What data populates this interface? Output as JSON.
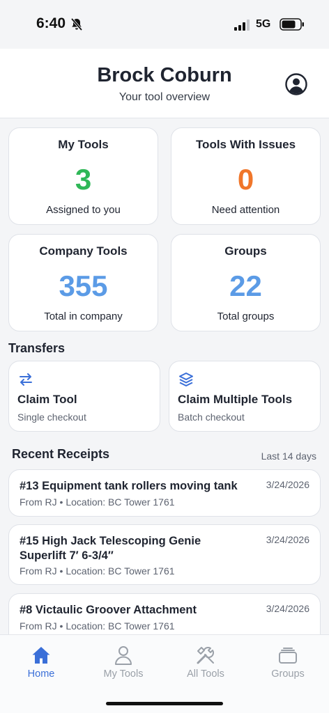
{
  "status_bar": {
    "time": "6:40",
    "network": "5G"
  },
  "header": {
    "title": "Brock Coburn",
    "subtitle": "Your tool overview"
  },
  "stats": [
    {
      "title": "My Tools",
      "value": "3",
      "caption": "Assigned to you",
      "color": "#2fb757"
    },
    {
      "title": "Tools With Issues",
      "value": "0",
      "caption": "Need attention",
      "color": "#f0762a"
    },
    {
      "title": "Company Tools",
      "value": "355",
      "caption": "Total in company",
      "color": "#5b9be6"
    },
    {
      "title": "Groups",
      "value": "22",
      "caption": "Total groups",
      "color": "#5b9be6"
    }
  ],
  "transfers": {
    "heading": "Transfers",
    "items": [
      {
        "title": "Claim Tool",
        "subtitle": "Single checkout",
        "icon": "swap-arrows-icon"
      },
      {
        "title": "Claim Multiple Tools",
        "subtitle": "Batch checkout",
        "icon": "layers-icon"
      }
    ]
  },
  "receipts": {
    "heading": "Recent Receipts",
    "range": "Last 14 days",
    "items": [
      {
        "title": "#13 Equipment tank rollers moving tank",
        "date": "3/24/2026",
        "meta": "From RJ • Location: BC Tower 1761"
      },
      {
        "title": "#15 High Jack Telescoping Genie Superlift 7′ 6-3/4″",
        "date": "3/24/2026",
        "meta": "From RJ • Location: BC Tower 1761"
      },
      {
        "title": "#8 Victaulic Groover Attachment",
        "date": "3/24/2026",
        "meta": "From RJ • Location: BC Tower 1761"
      }
    ]
  },
  "tabs": [
    {
      "label": "Home",
      "icon": "home-icon",
      "active": true
    },
    {
      "label": "My Tools",
      "icon": "person-icon",
      "active": false
    },
    {
      "label": "All Tools",
      "icon": "tools-icon",
      "active": false
    },
    {
      "label": "Groups",
      "icon": "folder-stack-icon",
      "active": false
    }
  ],
  "colors": {
    "accent": "#3a6fd8",
    "green": "#2fb757",
    "orange": "#f0762a",
    "blue": "#5b9be6"
  }
}
